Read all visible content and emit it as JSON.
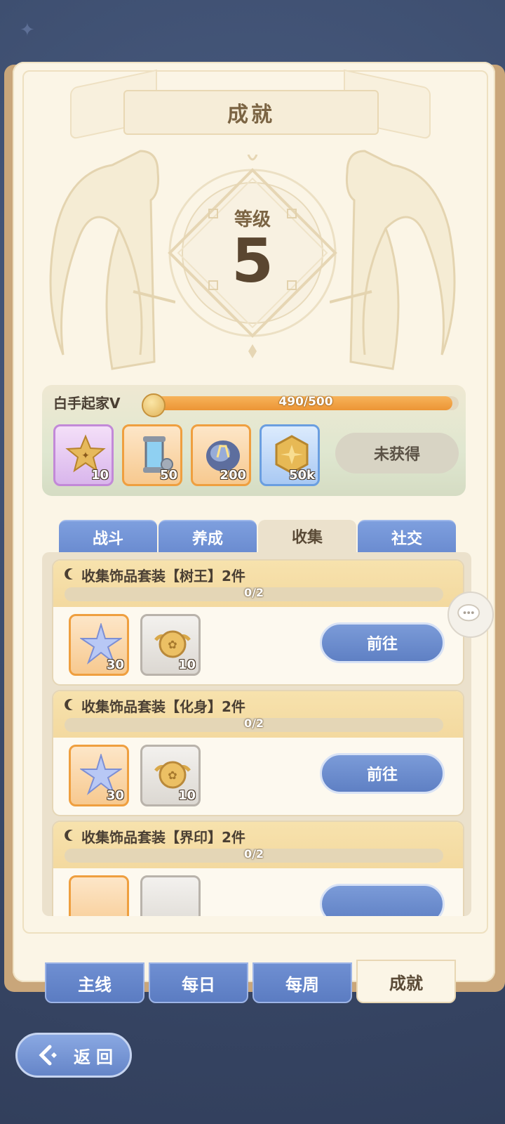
{
  "page_title": "成就",
  "level": {
    "label": "等级",
    "value": "5"
  },
  "rank": {
    "name": "白手起家Ⅴ",
    "progress_text": "490/500",
    "progress_fraction": 0.98,
    "rewards": [
      {
        "icon": "star-token-icon",
        "qty": "10",
        "rarity": "purple"
      },
      {
        "icon": "energy-canister-icon",
        "qty": "50",
        "rarity": "orange"
      },
      {
        "icon": "crystal-orb-icon",
        "qty": "200",
        "rarity": "orange"
      },
      {
        "icon": "gold-coin-icon",
        "qty": "50k",
        "rarity": "blue"
      }
    ],
    "status_button": "未获得"
  },
  "categories": [
    "战斗",
    "养成",
    "收集",
    "社交"
  ],
  "active_category": "收集",
  "tasks": [
    {
      "title": "收集饰品套装【树王】2件",
      "progress": "0/2",
      "fraction": 0,
      "rewards": [
        {
          "icon": "star-crystal-icon",
          "qty": "30"
        },
        {
          "icon": "winged-coin-icon",
          "qty": "10"
        }
      ],
      "button": "前往"
    },
    {
      "title": "收集饰品套装【化身】2件",
      "progress": "0/2",
      "fraction": 0,
      "rewards": [
        {
          "icon": "star-crystal-icon",
          "qty": "30"
        },
        {
          "icon": "winged-coin-icon",
          "qty": "10"
        }
      ],
      "button": "前往"
    },
    {
      "title": "收集饰品套装【界印】2件",
      "progress": "0/2",
      "fraction": 0,
      "rewards": [],
      "button": ""
    }
  ],
  "bottom_tabs": [
    "主线",
    "每日",
    "每周",
    "成就"
  ],
  "active_bottom_tab": "成就",
  "back_button": "返回"
}
